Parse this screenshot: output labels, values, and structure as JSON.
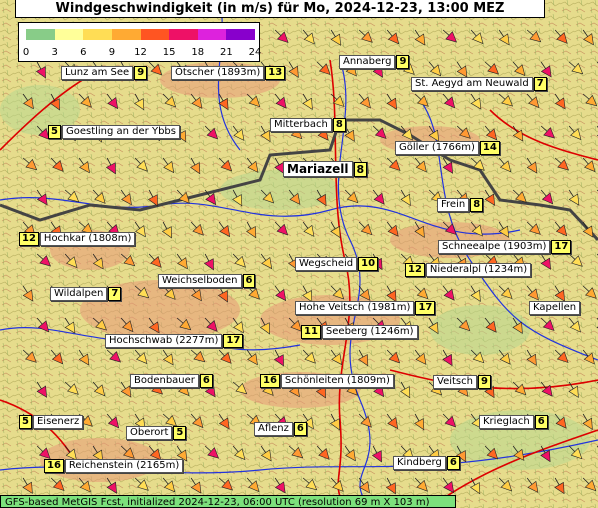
{
  "title": "Windgeschwindigkeit (in m/s) für Mo, 2024-12-23, 13:00 MEZ",
  "legend": {
    "colors": [
      "#88cc88",
      "#ffff99",
      "#ffdd55",
      "#ffaa33",
      "#ff5522",
      "#ee1166",
      "#dd22dd",
      "#8800cc"
    ],
    "ticks": [
      "0",
      "3",
      "6",
      "9",
      "12",
      "15",
      "18",
      "21",
      "24"
    ]
  },
  "places": [
    {
      "name": "Lunz am See",
      "value": "9",
      "side": "right"
    },
    {
      "name": "Ötscher (1893m)",
      "value": "13",
      "side": "right"
    },
    {
      "name": "Annaberg",
      "value": "9",
      "side": "right"
    },
    {
      "name": "St. Aegyd am Neuwald",
      "value": "7",
      "side": "right"
    },
    {
      "name": "Goestling an der Ybbs",
      "value": "5",
      "side": "left"
    },
    {
      "name": "Mitterbach",
      "value": "8",
      "side": "right"
    },
    {
      "name": "Göller (1766m)",
      "value": "14",
      "side": "right"
    },
    {
      "name": "Mariazell",
      "value": "8",
      "side": "right",
      "big": true
    },
    {
      "name": "Frein",
      "value": "8",
      "side": "right"
    },
    {
      "name": "Hochkar (1808m)",
      "value": "12",
      "side": "left"
    },
    {
      "name": "Schneealpe (1903m)",
      "value": "17",
      "side": "right"
    },
    {
      "name": "Wegscheid",
      "value": "10",
      "side": "right"
    },
    {
      "name": "Niederalpl (1234m)",
      "value": "12",
      "side": "left"
    },
    {
      "name": "Weichselboden",
      "value": "6",
      "side": "right"
    },
    {
      "name": "Wildalpen",
      "value": "7",
      "side": "right"
    },
    {
      "name": "Hohe Veitsch (1981m)",
      "value": "17",
      "side": "right"
    },
    {
      "name": "Kapellen",
      "value": "",
      "side": "none"
    },
    {
      "name": "Seeberg (1246m)",
      "value": "11",
      "side": "left"
    },
    {
      "name": "Hochschwab (2277m)",
      "value": "17",
      "side": "right"
    },
    {
      "name": "Bodenbauer",
      "value": "6",
      "side": "right"
    },
    {
      "name": "Schönleiten (1809m)",
      "value": "16",
      "side": "left"
    },
    {
      "name": "Veitsch",
      "value": "9",
      "side": "right"
    },
    {
      "name": "Eisenerz",
      "value": "5",
      "side": "left"
    },
    {
      "name": "Oberort",
      "value": "5",
      "side": "right"
    },
    {
      "name": "Aflenz",
      "value": "6",
      "side": "right"
    },
    {
      "name": "Krieglach",
      "value": "6",
      "side": "right"
    },
    {
      "name": "Reichenstein (2165m)",
      "value": "16",
      "side": "left"
    },
    {
      "name": "Kindberg",
      "value": "6",
      "side": "right"
    }
  ],
  "footer": "GFS-based MetGIS Fcst, initialized 2024-12-23, 06:00 UTC  (resolution 69 m X 103 m)"
}
